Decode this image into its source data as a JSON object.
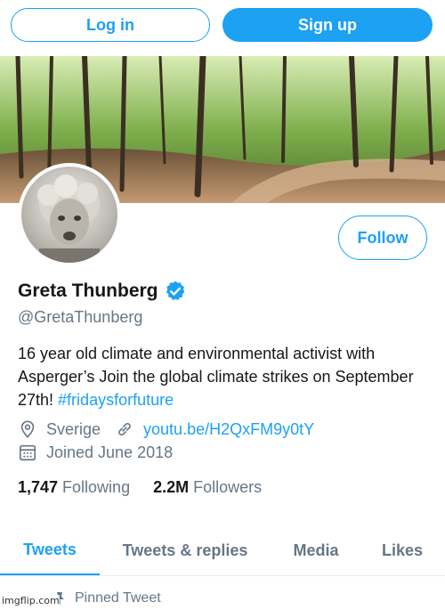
{
  "top_bar": {
    "login_label": "Log in",
    "signup_label": "Sign up"
  },
  "profile": {
    "name": "Greta Thunberg",
    "handle": "@GretaThunberg",
    "verified": true,
    "follow_label": "Follow",
    "bio_text": "16 year old climate and environmental activist with Asperger’s  Join the global climate strikes on September 27th! ",
    "bio_hashtag": "#fridaysforfuture",
    "location": "Sverige",
    "website": "youtu.be/H2QxFM9y0tY",
    "joined": "Joined June 2018",
    "following_count": "1,747",
    "following_label": "Following",
    "followers_count": "2.2M",
    "followers_label": "Followers"
  },
  "tabs": [
    {
      "label": "Tweets",
      "active": true
    },
    {
      "label": "Tweets & replies",
      "active": false
    },
    {
      "label": "Media",
      "active": false
    },
    {
      "label": "Likes",
      "active": false
    }
  ],
  "pinned_label": "Pinned Tweet",
  "watermark": "imgflip.com",
  "colors": {
    "accent": "#1da1f2",
    "muted": "#657786",
    "text": "#14171a"
  },
  "icons": [
    "verified-badge-icon",
    "location-pin-icon",
    "link-icon",
    "calendar-icon",
    "pin-icon"
  ]
}
